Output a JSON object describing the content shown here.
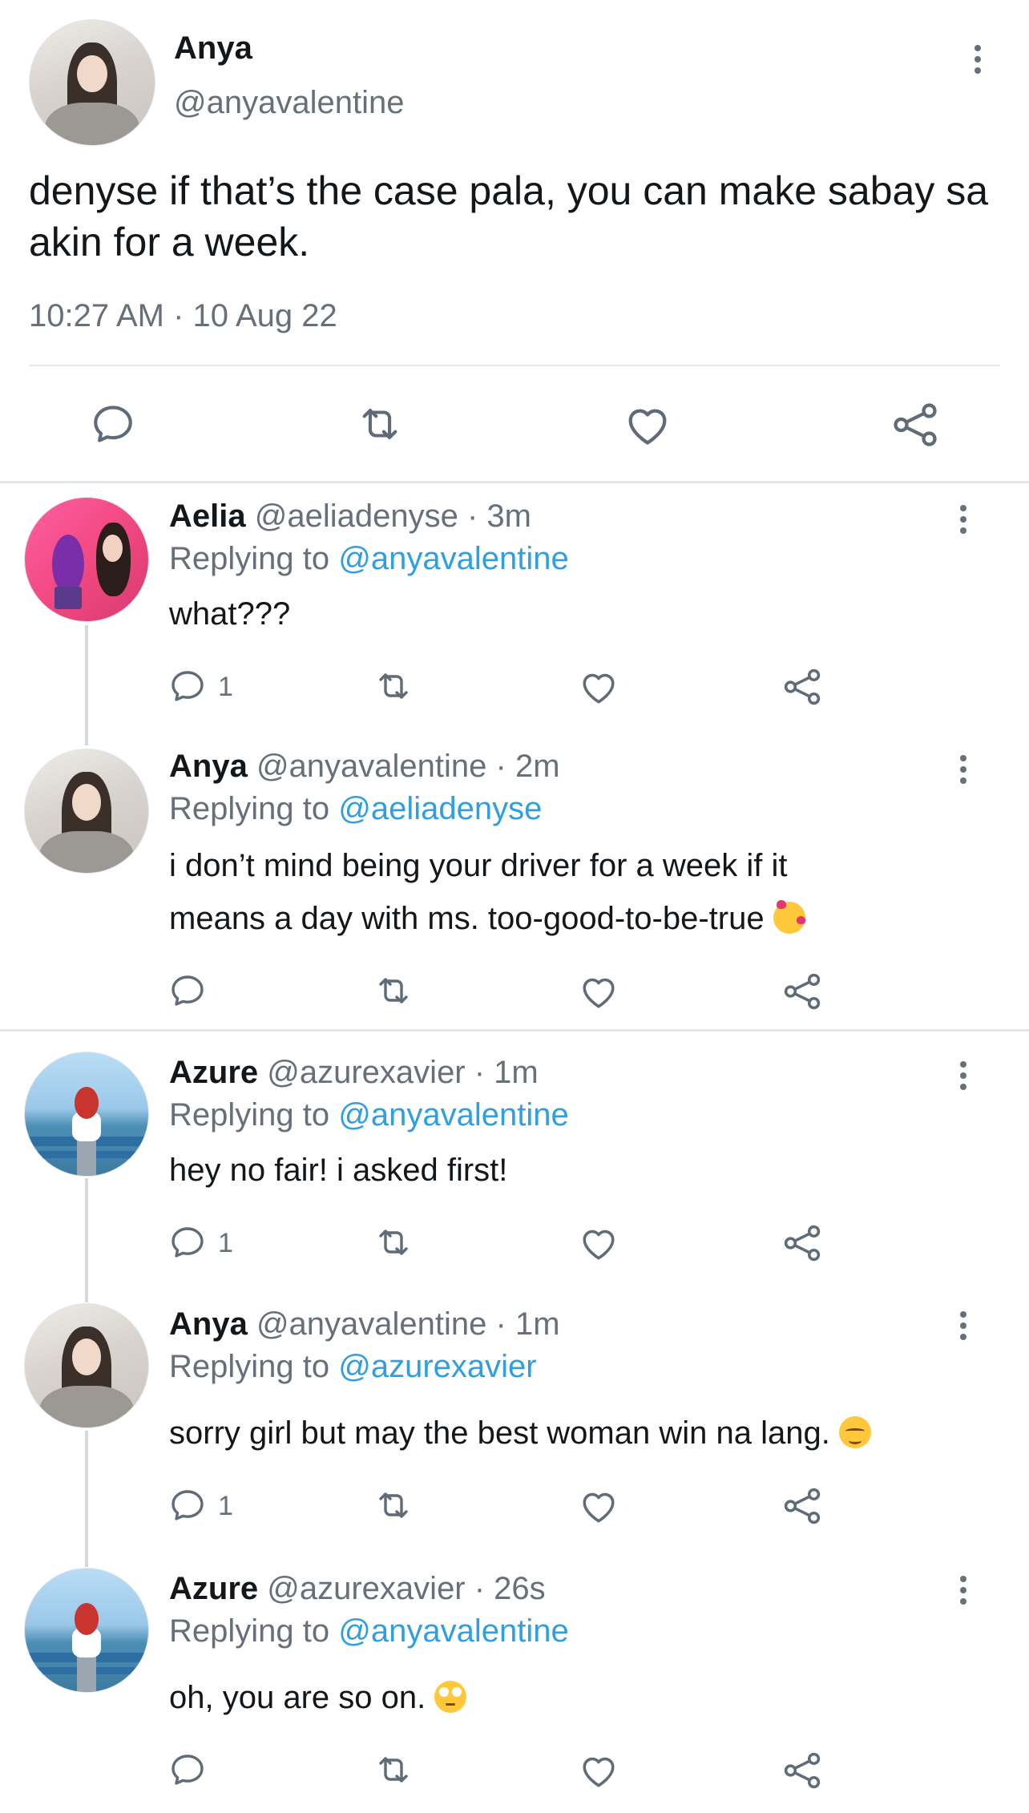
{
  "main_tweet": {
    "name": "Anya",
    "handle": "@anyavalentine",
    "text": "denyse if that’s the case pala, you can make sabay sa akin for a week.",
    "timestamp": "10:27 AM · 10 Aug 22"
  },
  "replies": [
    {
      "name": "Aelia",
      "handle_time": "@aeliadenyse · 3m",
      "replying_prefix": "Replying to",
      "replying_to": "@anyavalentine",
      "text": "what???",
      "reply_count": "1"
    },
    {
      "name": "Anya",
      "handle_time": "@anyavalentine · 2m",
      "replying_prefix": "Replying to",
      "replying_to": "@aeliadenyse",
      "text_line1": "i don’t mind being your driver for a week if it",
      "text_line2": "means a day with ms. too-good-to-be-true",
      "emoji": "smiling-face-with-hearts"
    },
    {
      "name": "Azure",
      "handle_time": "@azurexavier · 1m",
      "replying_prefix": "Replying to",
      "replying_to": "@anyavalentine",
      "text": "hey no fair! i asked first!",
      "reply_count": "1"
    },
    {
      "name": "Anya",
      "handle_time": "@anyavalentine · 1m",
      "replying_prefix": "Replying to",
      "replying_to": "@azurexavier",
      "text": "sorry girl but may the best woman win na lang.",
      "emoji": "relieved-face",
      "reply_count": "1"
    },
    {
      "name": "Azure",
      "handle_time": "@azurexavier · 26s",
      "replying_prefix": "Replying to",
      "replying_to": "@anyavalentine",
      "text": "oh, you are so on.",
      "emoji": "face-with-rolling-eyes"
    }
  ],
  "colors": {
    "link": "#2f9fe3",
    "muted": "#67707a",
    "divider": "#e3e7ea"
  }
}
